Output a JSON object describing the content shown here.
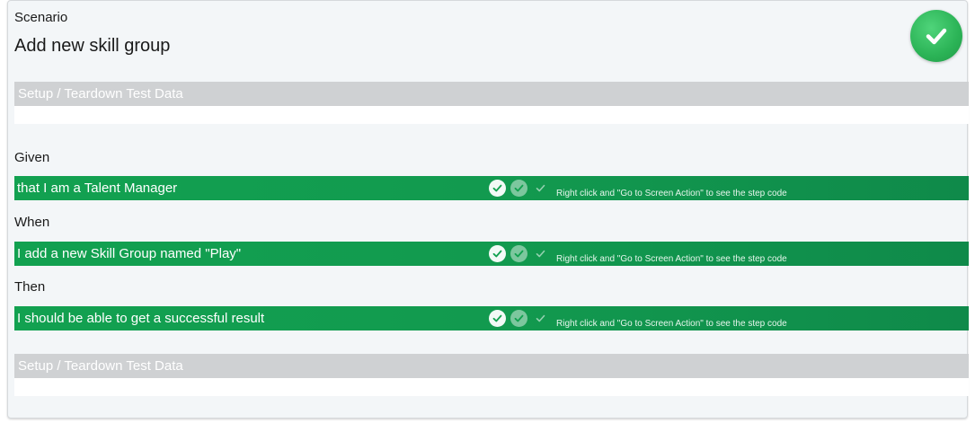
{
  "scenario": {
    "kicker": "Scenario",
    "title": "Add new skill group",
    "status_icon": "checkmark-icon",
    "status_color": "#2bb356"
  },
  "setup_top": {
    "label": "Setup / Teardown Test Data"
  },
  "setup_bottom": {
    "label": "Setup / Teardown Test Data"
  },
  "steps": [
    {
      "keyword": "Given",
      "text": "that I am a Talent Manager",
      "hint": "Right click and \"Go to Screen Action\" to see the step code"
    },
    {
      "keyword": "When",
      "text": "I add a new Skill Group  named \"Play\"",
      "hint": "Right click and \"Go to Screen Action\" to see the step code"
    },
    {
      "keyword": "Then",
      "text": "I should be able to get a successful result",
      "hint": "Right click and \"Go to Screen Action\" to see the step code"
    }
  ],
  "colors": {
    "step_green": "#12a150",
    "section_gray": "#cfd1d3",
    "card_bg": "#f3f6f8"
  }
}
